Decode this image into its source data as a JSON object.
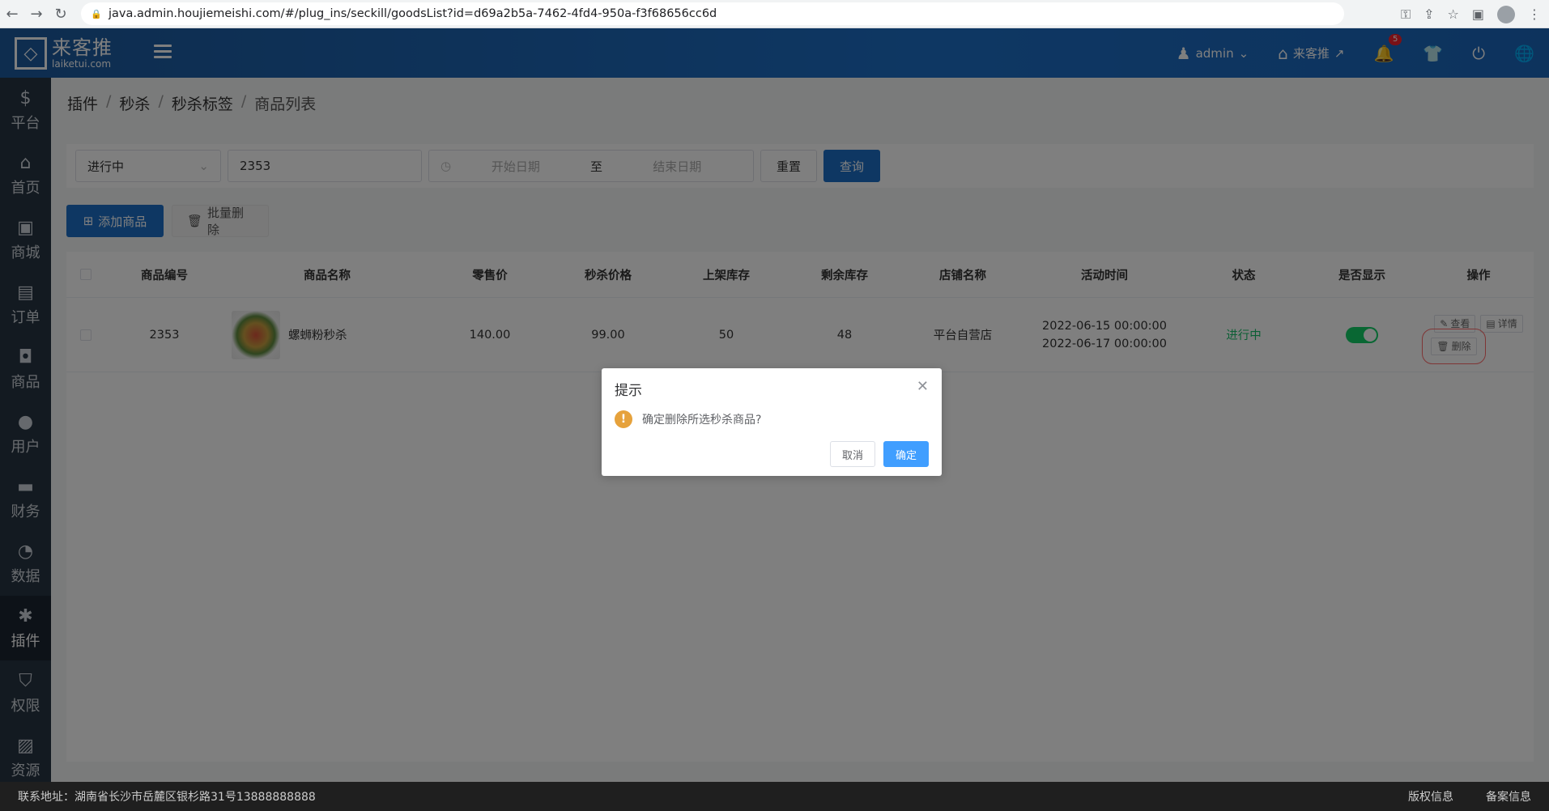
{
  "browser": {
    "url": "java.admin.houjiemeishi.com/#/plug_ins/seckill/goodsList?id=d69a2b5a-7462-4fd4-950a-f3f68656cc6d"
  },
  "header": {
    "logo_main": "来客推",
    "logo_sub": "laiketui.com",
    "user": "admin",
    "store_link": "来客推",
    "notification_count": "5"
  },
  "sidebar": {
    "items": [
      {
        "label": "平台",
        "icon": "platform-icon"
      },
      {
        "label": "首页",
        "icon": "home-icon"
      },
      {
        "label": "商城",
        "icon": "mall-icon"
      },
      {
        "label": "订单",
        "icon": "order-icon"
      },
      {
        "label": "商品",
        "icon": "goods-icon"
      },
      {
        "label": "用户",
        "icon": "user-icon"
      },
      {
        "label": "财务",
        "icon": "wallet-icon"
      },
      {
        "label": "数据",
        "icon": "pie-chart-icon"
      },
      {
        "label": "插件",
        "icon": "puzzle-icon",
        "active": true
      },
      {
        "label": "权限",
        "icon": "shield-icon"
      },
      {
        "label": "资源",
        "icon": "image-icon"
      }
    ]
  },
  "breadcrumb": [
    "插件",
    "秒杀",
    "秒杀标签",
    "商品列表"
  ],
  "filter": {
    "status_value": "进行中",
    "search_value": "2353",
    "start_placeholder": "开始日期",
    "range_sep": "至",
    "end_placeholder": "结束日期",
    "reset_label": "重置",
    "query_label": "查询"
  },
  "actions": {
    "add_label": "添加商品",
    "batch_delete_label": "批量删除"
  },
  "table": {
    "columns": [
      "商品编号",
      "商品名称",
      "零售价",
      "秒杀价格",
      "上架库存",
      "剩余库存",
      "店铺名称",
      "活动时间",
      "状态",
      "是否显示",
      "操作"
    ],
    "rows": [
      {
        "id": "2353",
        "name": "螺蛳粉秒杀",
        "retail_price": "140.00",
        "seckill_price": "99.00",
        "stock": "50",
        "remaining": "48",
        "store": "平台自营店",
        "time_start": "2022-06-15 00:00:00",
        "time_end": "2022-06-17 00:00:00",
        "status": "进行中",
        "op_view": "查看",
        "op_detail": "详情",
        "op_delete": "删除"
      }
    ]
  },
  "dialog": {
    "title": "提示",
    "message": "确定删除所选秒杀商品?",
    "cancel_label": "取消",
    "confirm_label": "确定"
  },
  "footer": {
    "address": "联系地址：湖南省长沙市岳麓区银杉路31号13888888888",
    "copyright": "版权信息",
    "record": "备案信息"
  }
}
